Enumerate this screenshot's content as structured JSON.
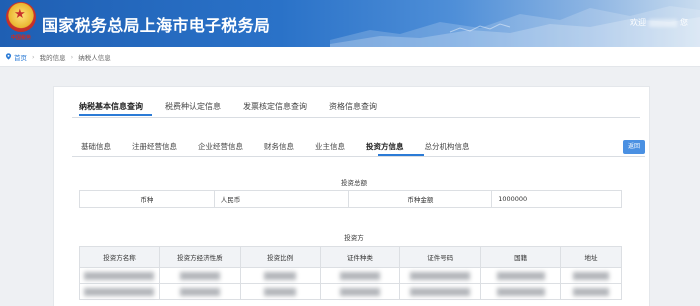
{
  "header": {
    "title": "国家税务总局上海市电子税务局",
    "emblem_text": "中国税务",
    "welcome": "欢迎",
    "user_suffix": "您"
  },
  "breadcrumb": {
    "items": [
      "首页",
      "我的信息",
      "纳税人信息"
    ]
  },
  "main_tabs": [
    "纳税基本信息查询",
    "税费种认定信息",
    "发票核定信息查询",
    "资格信息查询"
  ],
  "sub_tabs": [
    "基础信息",
    "注册经营信息",
    "企业经营信息",
    "财务信息",
    "业主信息",
    "投资方信息",
    "总分机构信息"
  ],
  "return_button": "返回",
  "investment_total": {
    "title": "投资总额",
    "currency_label": "币种",
    "currency_value": "人民币",
    "amount_label": "币种金额",
    "amount_value": "1000000"
  },
  "investors": {
    "title": "投资方",
    "columns": [
      "投资方名称",
      "投资方经济性质",
      "投资比例",
      "证件种类",
      "证件号码",
      "国籍",
      "地址"
    ],
    "rows": [
      [
        "",
        "",
        "",
        "",
        "",
        "",
        ""
      ],
      [
        "",
        "",
        "",
        "",
        "",
        "",
        ""
      ]
    ]
  },
  "colors": {
    "accent": "#2b7bd6",
    "header_start": "#1f5fb3",
    "button": "#4a90e2"
  }
}
